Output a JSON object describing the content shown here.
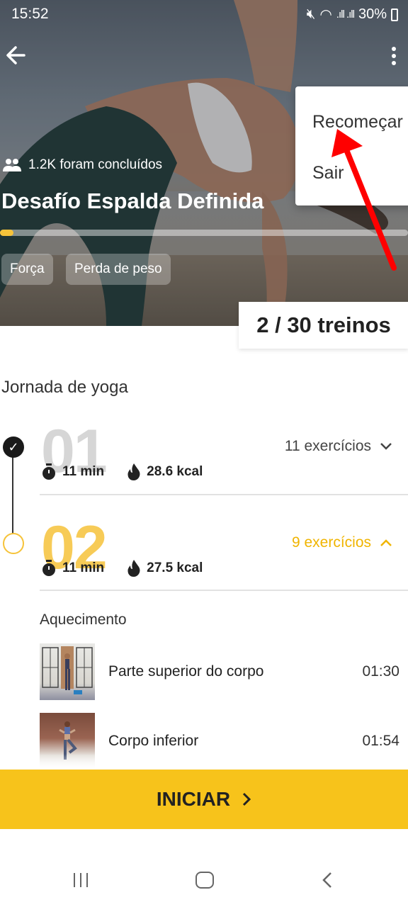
{
  "status_bar": {
    "time": "15:52",
    "battery": "30%"
  },
  "hero": {
    "completed_text": "1.2K foram concluídos",
    "title": "Desafío Espalda Definida",
    "progress_fraction": 0.033,
    "tags": [
      "Força",
      "Perda de peso"
    ],
    "workouts_badge": "2 / 30 treinos"
  },
  "menu": {
    "items": [
      "Recomeçar",
      "Sair"
    ]
  },
  "section": {
    "title": "Jornada de yoga"
  },
  "days": [
    {
      "number": "01",
      "exercises_label": "11 exercícios",
      "duration": "11 min",
      "calories": "28.6 kcal",
      "state": "completed"
    },
    {
      "number": "02",
      "exercises_label": "9 exercícios",
      "duration": "11 min",
      "calories": "27.5 kcal",
      "state": "active"
    }
  ],
  "warmup": {
    "title": "Aquecimento",
    "exercises": [
      {
        "name": "Parte superior do corpo",
        "time": "01:30"
      },
      {
        "name": "Corpo inferior",
        "time": "01:54"
      }
    ]
  },
  "start_button": {
    "label": "INICIAR"
  },
  "colors": {
    "accent": "#f7c31b",
    "active_text": "#f0b400",
    "annotation_arrow": "#ff0000"
  },
  "icons": {
    "back": "arrow-left-icon",
    "more": "more-vertical-icon",
    "people": "people-icon",
    "timer": "stopwatch-icon",
    "calories": "flame-icon"
  }
}
